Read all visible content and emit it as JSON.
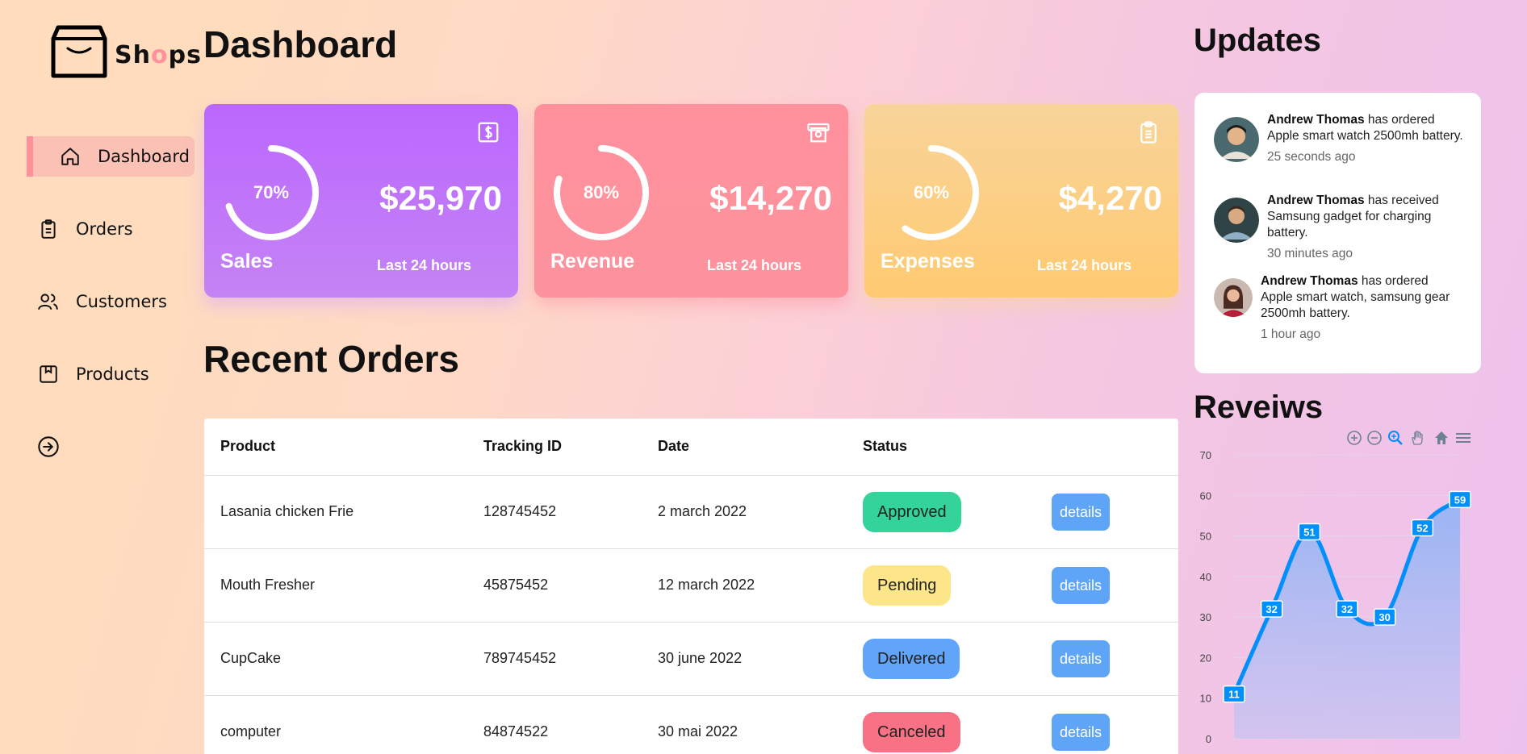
{
  "brand": {
    "prefix": "Sh",
    "highlight": "o",
    "suffix": "ps"
  },
  "sidebar": {
    "items": [
      {
        "label": "Dashboard",
        "icon": "home-icon",
        "active": true
      },
      {
        "label": "Orders",
        "icon": "clipboard-icon"
      },
      {
        "label": "Customers",
        "icon": "users-icon"
      },
      {
        "label": "Products",
        "icon": "package-icon"
      },
      {
        "label": "",
        "icon": "sign-out-icon"
      }
    ]
  },
  "main": {
    "title": "Dashboard",
    "cards": [
      {
        "name": "Sales",
        "percent": "70%",
        "percent_value": 70,
        "amount": "$25,970",
        "period": "Last 24 hours",
        "icon": "dollar-icon",
        "color": "#bb67ff"
      },
      {
        "name": "Revenue",
        "percent": "80%",
        "percent_value": 80,
        "amount": "$14,270",
        "period": "Last 24 hours",
        "icon": "money-icon",
        "color": "#ff919d"
      },
      {
        "name": "Expenses",
        "percent": "60%",
        "percent_value": 60,
        "amount": "$4,270",
        "period": "Last 24 hours",
        "icon": "clipboard-icon",
        "color": "#ffca71"
      }
    ],
    "orders_title": "Recent Orders",
    "table": {
      "headers": [
        "Product",
        "Tracking ID",
        "Date",
        "Status"
      ],
      "rows": [
        {
          "product": "Lasania chicken Frie",
          "tracking": "128745452",
          "date": "2 march 2022",
          "status": "Approved",
          "status_color": "#34d399",
          "action": "details"
        },
        {
          "product": "Mouth Fresher",
          "tracking": "45875452",
          "date": "12 march 2022",
          "status": "Pending",
          "status_color": "#fde68a",
          "action": "details"
        },
        {
          "product": "CupCake",
          "tracking": "789745452",
          "date": "30 june 2022",
          "status": "Delivered",
          "status_color": "#60a5fa",
          "action": "details"
        },
        {
          "product": "computer",
          "tracking": "84874522",
          "date": "30 mai 2022",
          "status": "Canceled",
          "status_color": "#f87185",
          "action": "details"
        }
      ]
    }
  },
  "right": {
    "updates_title": "Updates",
    "updates": [
      {
        "name": "Andrew Thomas",
        "text": " has ordered Apple smart watch 2500mh battery.",
        "time": "25 seconds ago",
        "avatar": "avatar-1-icon"
      },
      {
        "name": "Andrew Thomas",
        "text": " has received Samsung gadget for charging battery.",
        "time": "30 minutes ago",
        "avatar": "avatar-2-icon"
      },
      {
        "name": "Andrew Thomas",
        "text": " has ordered Apple smart watch, samsung gear 2500mh battery.",
        "time": "1 hour ago",
        "avatar": "avatar-3-icon"
      }
    ],
    "reviews_title": "Reveiws"
  },
  "chart_data": {
    "type": "area",
    "x": [
      1,
      2,
      3,
      4,
      5,
      6,
      7
    ],
    "series": [
      {
        "values": [
          11,
          32,
          51,
          32,
          30,
          52,
          59
        ]
      }
    ],
    "ylim": [
      0,
      70
    ],
    "yticks": [
      "0",
      "10",
      "20",
      "30",
      "40",
      "50",
      "60",
      "70"
    ],
    "data_labels": true,
    "grid": true,
    "toolbar": [
      "zoom-in-icon",
      "zoom-out-icon",
      "zoom-select-icon",
      "pan-icon",
      "home-icon",
      "menu-icon"
    ]
  }
}
